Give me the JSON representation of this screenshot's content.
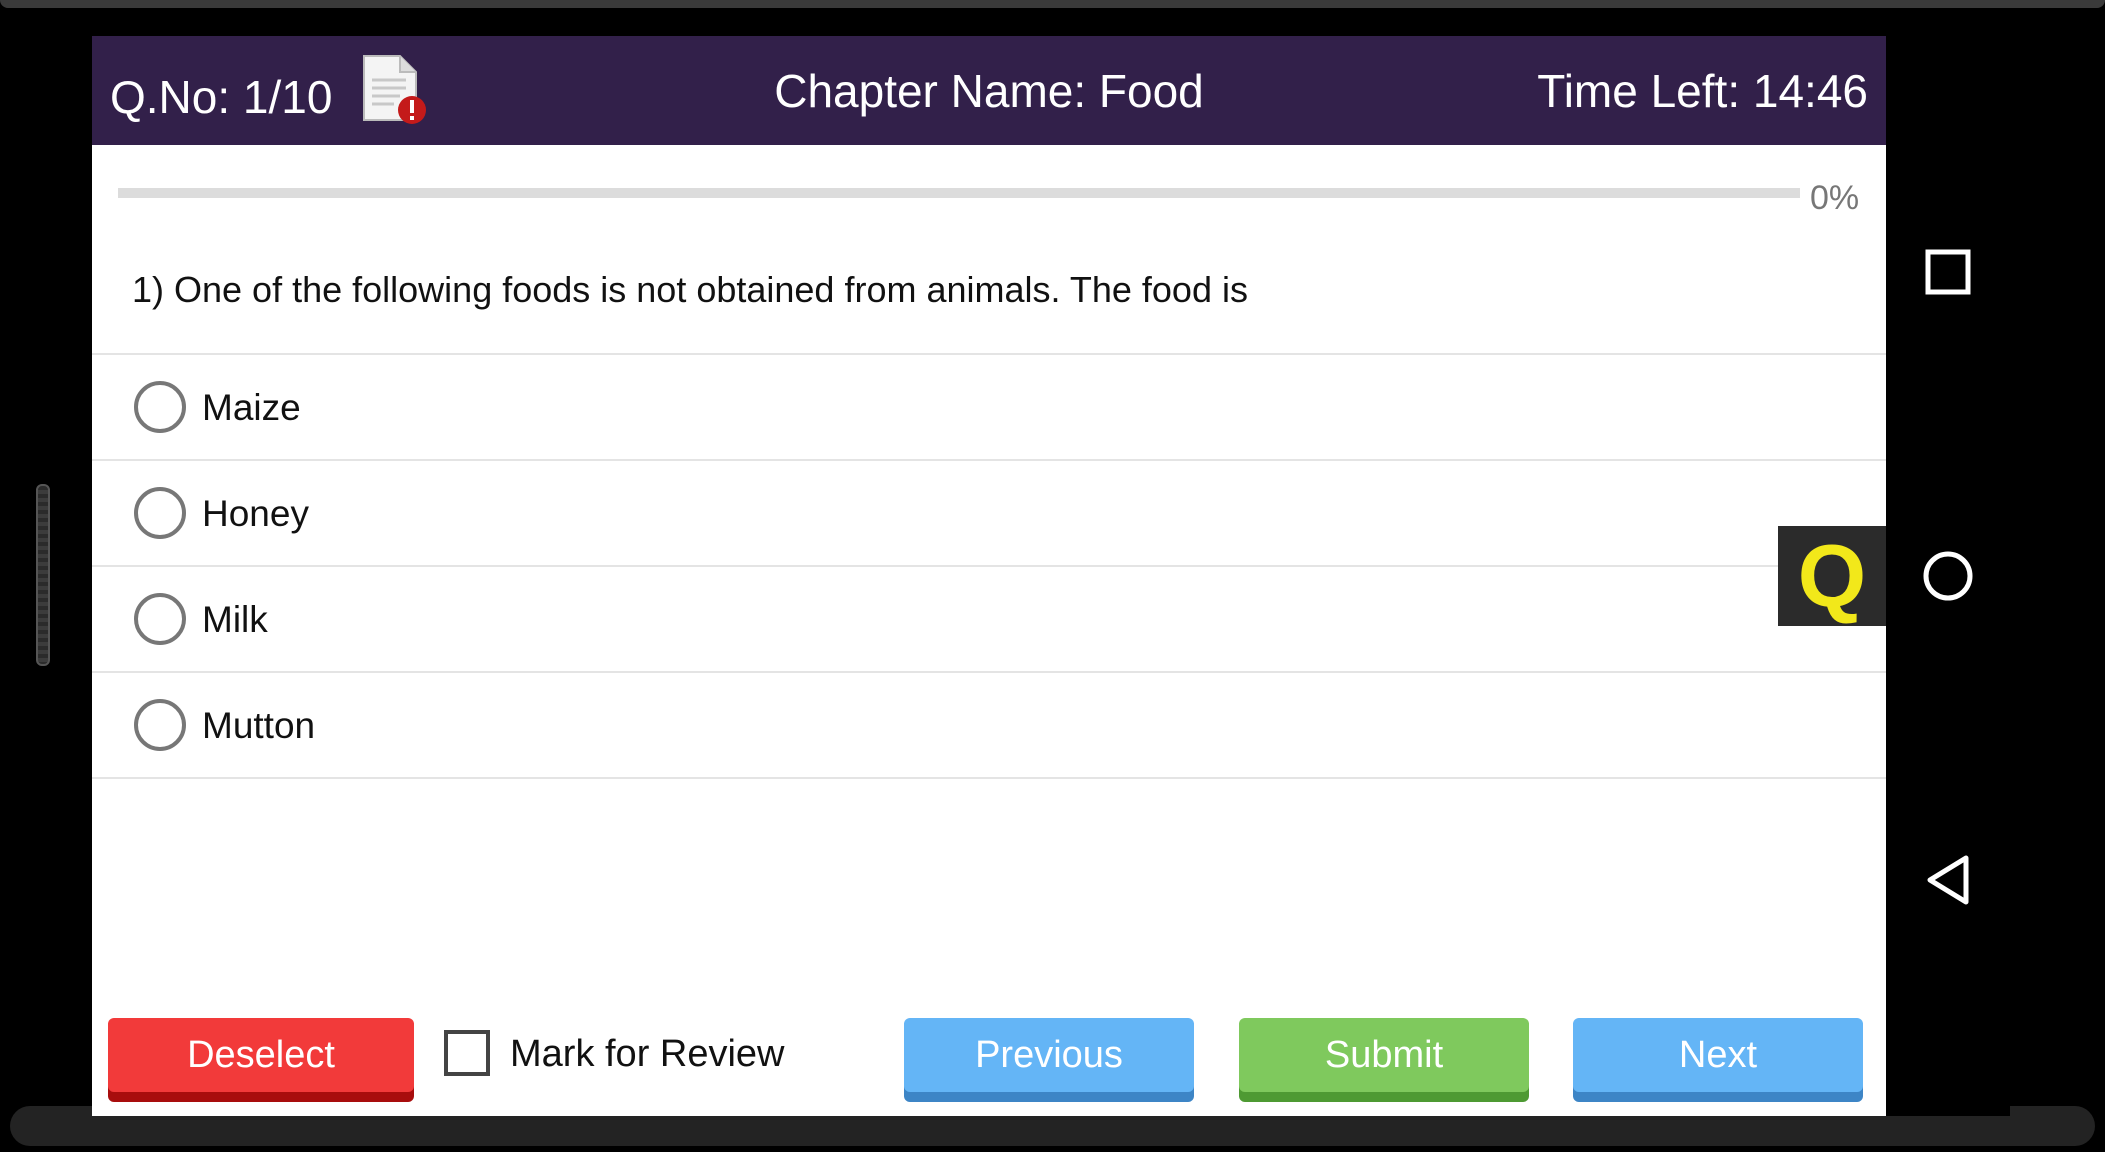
{
  "header": {
    "question_number": "Q.No: 1/10",
    "chapter": "Chapter Name: Food",
    "time_left": "Time Left: 14:46",
    "report_icon": "report-document-icon"
  },
  "progress": {
    "fraction": 0,
    "label": "0%"
  },
  "question": {
    "text": "1) One of the following foods is not obtained from animals. The food is"
  },
  "options": [
    {
      "label": "Maize",
      "selected": false
    },
    {
      "label": "Honey",
      "selected": false
    },
    {
      "label": "Milk",
      "selected": false
    },
    {
      "label": "Mutton",
      "selected": false
    }
  ],
  "badge": {
    "letter": "Q",
    "color": "#f2e81a"
  },
  "footer": {
    "deselect_label": "Deselect",
    "review_label": "Mark for Review",
    "review_checked": false,
    "previous_label": "Previous",
    "submit_label": "Submit",
    "next_label": "Next"
  },
  "colors": {
    "header_bg": "#32204a",
    "deselect": "#f23a3a",
    "previous": "#64b5f6",
    "submit": "#7fc95d",
    "next": "#64b5f6"
  },
  "system_nav": {
    "icons": [
      "recents-square-icon",
      "home-circle-icon",
      "back-triangle-icon"
    ]
  }
}
